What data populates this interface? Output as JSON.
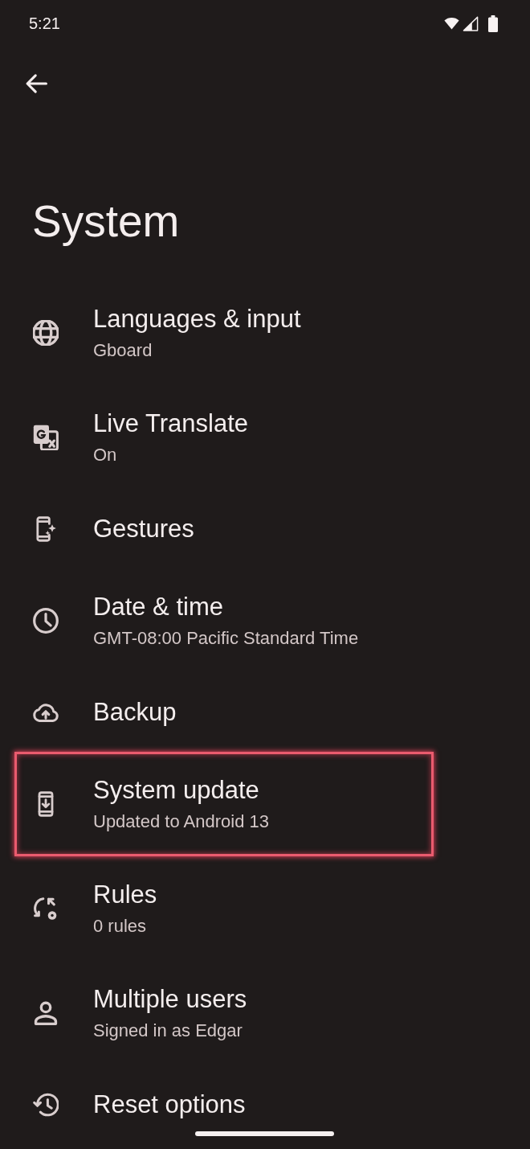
{
  "status_bar": {
    "time": "5:21"
  },
  "header": {
    "title": "System"
  },
  "items": [
    {
      "title": "Languages & input",
      "summary": "Gboard",
      "highlighted": false
    },
    {
      "title": "Live Translate",
      "summary": "On",
      "highlighted": false
    },
    {
      "title": "Gestures",
      "highlighted": false
    },
    {
      "title": "Date & time",
      "summary": "GMT-08:00 Pacific Standard Time",
      "highlighted": false
    },
    {
      "title": "Backup",
      "highlighted": false
    },
    {
      "title": "System update",
      "summary": "Updated to Android 13",
      "highlighted": true
    },
    {
      "title": "Rules",
      "summary": "0 rules",
      "highlighted": false
    },
    {
      "title": "Multiple users",
      "summary": "Signed in as Edgar",
      "highlighted": false
    },
    {
      "title": "Reset options",
      "highlighted": false
    }
  ]
}
